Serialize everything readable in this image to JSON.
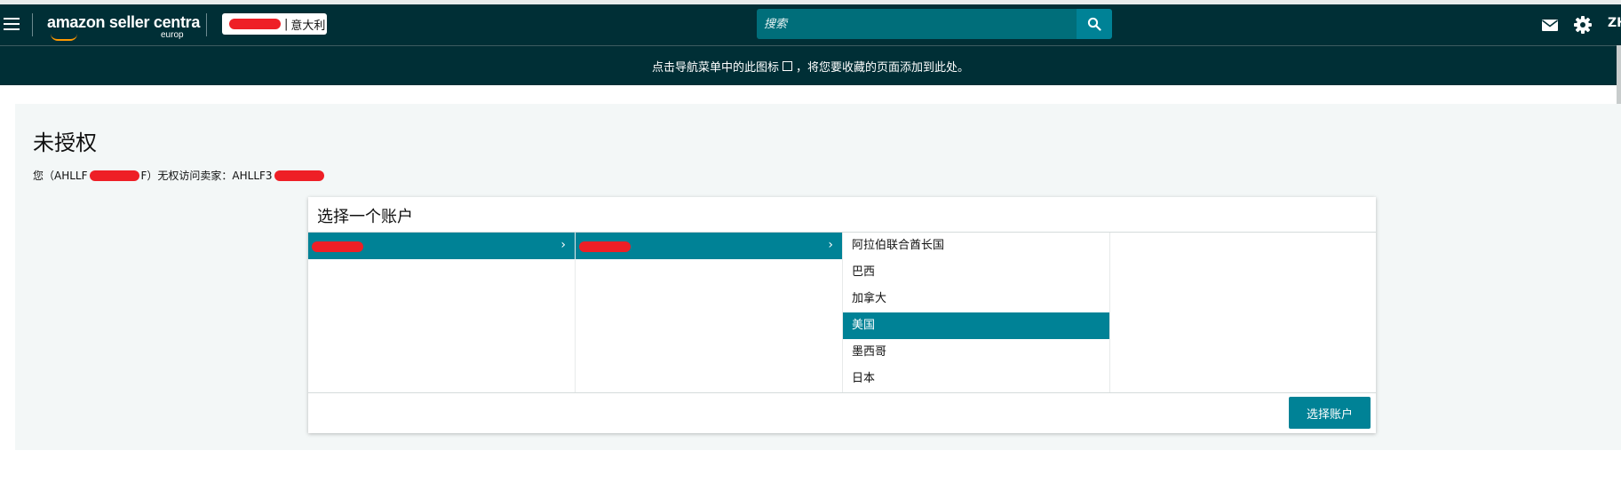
{
  "header": {
    "logo_main": "amazon seller centra",
    "logo_sub": "europ",
    "store_region": "意大利",
    "search_placeholder": "搜索",
    "language": "ZH"
  },
  "favorites_bar": {
    "text_before": "点击导航菜单中的此图标",
    "text_after": "，将您要收藏的页面添加到此处。"
  },
  "page": {
    "title": "未授权",
    "message_part1": "您（AHLLF",
    "message_part2": "F）无权访问卖家：AHLLF3"
  },
  "dialog": {
    "title": "选择一个账户",
    "countries": [
      "阿拉伯联合酋长国",
      "巴西",
      "加拿大",
      "美国",
      "墨西哥",
      "日本"
    ],
    "selected_country_index": 3,
    "select_button_label": "选择账户"
  },
  "colors": {
    "navbar": "#002f36",
    "accent": "#008296",
    "search_bg": "#006e7a"
  }
}
